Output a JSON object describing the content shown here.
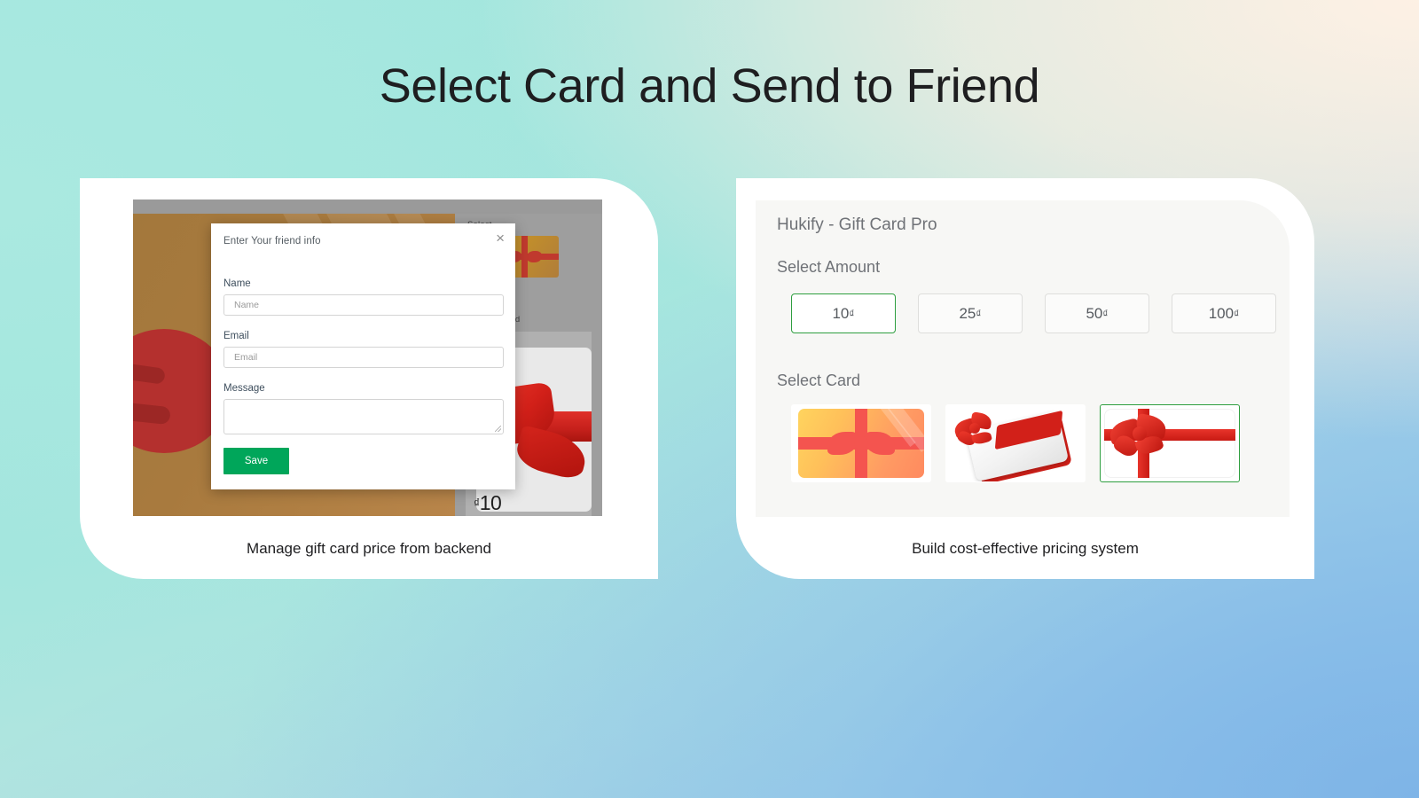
{
  "page": {
    "title": "Select Card and Send to Friend",
    "background_colors": {
      "mint": "#b2ebe2",
      "cream": "#fdf0e6",
      "blue": "#8bc0e8"
    }
  },
  "panels": [
    {
      "caption": "Manage gift card price from backend",
      "screenshot": {
        "modal": {
          "title": "Enter Your friend info",
          "close_icon": "close-icon",
          "fields": [
            {
              "label": "Name",
              "placeholder": "Name",
              "value": "",
              "type": "text"
            },
            {
              "label": "Email",
              "placeholder": "Email",
              "value": "",
              "type": "text"
            },
            {
              "label": "Message",
              "placeholder": "",
              "value": "",
              "type": "textarea"
            }
          ],
          "save_label": "Save",
          "save_color": "#00a65a"
        },
        "sidebar": {
          "select_label": "Select",
          "preview_label": "Preview Card",
          "price": "10",
          "currency": "₫",
          "thumbnail_name": "gold-gift-card-thumbnail"
        }
      }
    },
    {
      "caption": "Build cost-effective pricing system",
      "store": {
        "brand": "Hukify - Gift Card Pro",
        "amount_section_label": "Select Amount",
        "amounts": [
          {
            "value": "10",
            "currency": "₫",
            "selected": true
          },
          {
            "value": "25",
            "currency": "₫",
            "selected": false
          },
          {
            "value": "50",
            "currency": "₫",
            "selected": false
          },
          {
            "value": "100",
            "currency": "₫",
            "selected": false
          }
        ],
        "card_section_label": "Select Card",
        "cards": [
          {
            "name": "orange-gift-card",
            "selected": false
          },
          {
            "name": "white-envelope-card",
            "selected": false
          },
          {
            "name": "white-ribbon-gift-card",
            "selected": true
          }
        ],
        "selected_color": "#2e9e3f"
      }
    }
  ]
}
